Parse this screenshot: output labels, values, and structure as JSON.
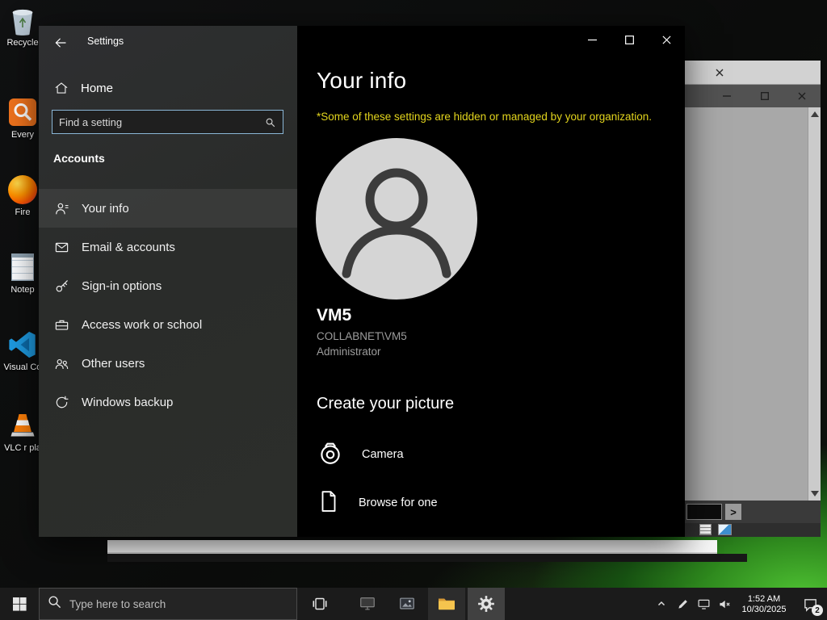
{
  "desktop": {
    "icons": [
      {
        "name": "recycle-bin",
        "label": "Recycle"
      },
      {
        "name": "everything",
        "label": "Every"
      },
      {
        "name": "firefox",
        "label": "Fire"
      },
      {
        "name": "notepad",
        "label": "Notep"
      },
      {
        "name": "vscode",
        "label": "Visual Co"
      },
      {
        "name": "vlc",
        "label": "VLC r pla"
      }
    ]
  },
  "background_window": {
    "prompt_symbol": ">"
  },
  "settings_window": {
    "title": "Settings",
    "nav": {
      "home_label": "Home",
      "search_placeholder": "Find a setting",
      "section_header": "Accounts",
      "items": [
        {
          "label": "Your info",
          "icon": "person-icon"
        },
        {
          "label": "Email & accounts",
          "icon": "mail-icon"
        },
        {
          "label": "Sign-in options",
          "icon": "key-icon"
        },
        {
          "label": "Access work or school",
          "icon": "briefcase-icon"
        },
        {
          "label": "Other users",
          "icon": "people-icon"
        },
        {
          "label": "Windows backup",
          "icon": "sync-icon"
        }
      ]
    },
    "content": {
      "page_title": "Your info",
      "org_notice": "*Some of these settings are hidden or managed by your organization.",
      "account_name": "VM5",
      "account_domain": "COLLABNET\\VM5",
      "account_role": "Administrator",
      "create_picture_heading": "Create your picture",
      "camera_label": "Camera",
      "browse_label": "Browse for one"
    }
  },
  "taskbar": {
    "search_placeholder": "Type here to search",
    "clock": {
      "time": "1:52 AM",
      "date": "10/30/2025"
    },
    "notification_badge": "2"
  },
  "colors": {
    "accent_blue": "#0078d7",
    "notice_yellow": "#e3d51d",
    "left_pane_bg": "#2b2b2b",
    "right_pane_bg": "#000000",
    "taskbar_bg": "#1b1b1b"
  }
}
